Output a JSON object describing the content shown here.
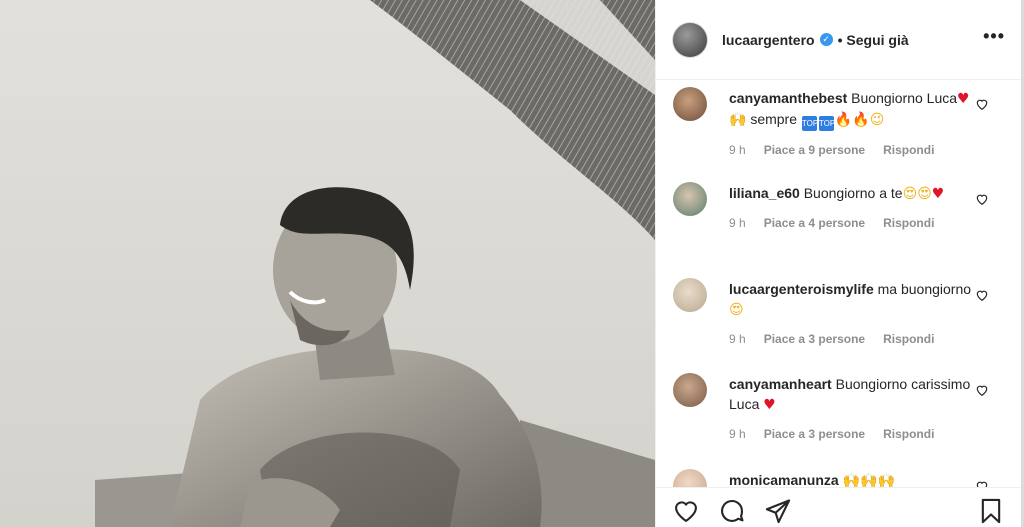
{
  "post": {
    "username": "lucaargentero",
    "verified": true,
    "follow_status": "Segui già",
    "more_label": "•••"
  },
  "comments": [
    {
      "username": "canyamanthebest",
      "text_before": "Buongiorno Luca",
      "text_middle": " sempre ",
      "time": "9 h",
      "likes": "Piace a 9 persone",
      "reply": "Rispondi",
      "avatar_color": "#6d4c3a"
    },
    {
      "username": "liliana_e60",
      "text_before": "Buongiorno a te",
      "time": "9 h",
      "likes": "Piace a 4 persone",
      "reply": "Rispondi",
      "avatar_color": "#5a7d6a"
    },
    {
      "username": "lucaargenteroismylife",
      "text_before": "ma buongiorno",
      "time": "9 h",
      "likes": "Piace a 3 persone",
      "reply": "Rispondi",
      "avatar_color": "#b8a78e"
    },
    {
      "username": "canyamanheart",
      "text_before": "Buongiorno carissimo Luca",
      "time": "9 h",
      "likes": "Piace a 3 persone",
      "reply": "Rispondi",
      "avatar_color": "#7a5a44"
    },
    {
      "username": "monicamanunza",
      "avatar_color": "#c9a48a"
    }
  ],
  "emoji": {
    "heart": "♥",
    "hands": "🙌",
    "fire": "🔥",
    "wink": "😉",
    "heart_eyes": "😍",
    "top_badge": "TOP"
  },
  "icons": {
    "like": "heart-outline-icon",
    "comment": "comment-bubble-icon",
    "share": "paper-plane-icon",
    "save": "bookmark-icon",
    "comment_like": "small-heart-icon"
  },
  "colors": {
    "verified": "#3897f0",
    "secondary_text": "#8e8e8e",
    "border": "#efefef"
  }
}
